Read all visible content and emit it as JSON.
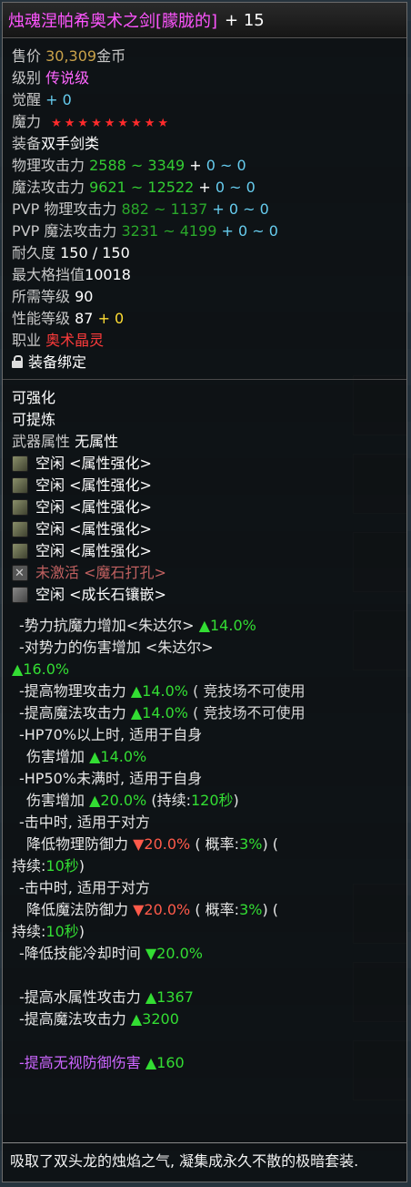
{
  "item": {
    "name": "烛魂涅帕希奥术之剑[朦胧的]",
    "enhance": "+ 15",
    "price_label": "售价",
    "price_value": "30,309",
    "price_unit": "金币",
    "grade_label": "级别",
    "grade_value": "传说级",
    "awaken_label": "觉醒",
    "awaken_value": "+ 0",
    "magic_label": "魔力",
    "stars": [
      "★",
      "★",
      "★",
      "★",
      "★",
      "★",
      "★",
      "★",
      "★"
    ],
    "equip_label": "装备",
    "equip_value": "双手剑类",
    "phys_label": "物理攻击力",
    "phys_value": "2588 ~ 3349",
    "phys_bonus_plus": "+",
    "phys_bonus": "0 ~ 0",
    "mag_label": "魔法攻击力",
    "mag_value": "9621 ~ 12522",
    "mag_bonus_plus": "+",
    "mag_bonus": "0 ~ 0",
    "pvp_phys_label": "PVP 物理攻击力",
    "pvp_phys_value": "882 ~ 1137",
    "pvp_phys_bonus": "+ 0 ~ 0",
    "pvp_mag_label": "PVP 魔法攻击力",
    "pvp_mag_value": "3231 ~ 4199",
    "pvp_mag_bonus": "+ 0 ~ 0",
    "durability_label": "耐久度",
    "durability_value": "150 / 150",
    "block_label": "最大格挡值",
    "block_value": "10018",
    "req_level_label": "所需等级",
    "req_level_value": "90",
    "perf_label": "性能等级",
    "perf_value": "87",
    "perf_bonus": "+ 0",
    "class_label": "职业",
    "class_value": "奥术晶灵",
    "bound_label": "装备绑定"
  },
  "sockets": {
    "enhanceable": "可强化",
    "refinable": "可提炼",
    "attr_label": "武器属性",
    "attr_value": "无属性",
    "slots": [
      {
        "state": "空闲",
        "desc": "<属性强化>"
      },
      {
        "state": "空闲",
        "desc": "<属性强化>"
      },
      {
        "state": "空闲",
        "desc": "<属性强化>"
      },
      {
        "state": "空闲",
        "desc": "<属性强化>"
      },
      {
        "state": "空闲",
        "desc": "<属性强化>"
      }
    ],
    "inactive_state": "未激活",
    "inactive_desc": "<魔石打孔>",
    "growth_state": "空闲",
    "growth_desc": "<成长石镶嵌>"
  },
  "effects": {
    "e1_text": "-势力抗魔力增加<朱达尔>",
    "e1_val": "▲14.0%",
    "e2_text": "-对势力的伤害增加 <朱达尔>",
    "e2_val": "▲16.0%",
    "e3_text": "-提高物理攻击力",
    "e3_val": "▲14.0%",
    "e3_note": "( 竞技场不可使用",
    "e4_text": "-提高魔法攻击力",
    "e4_val": "▲14.0%",
    "e4_note": "( 竞技场不可使用",
    "e5_line1": "-HP70%以上时, 适用于自身",
    "e5_text": "伤害增加",
    "e5_val": "▲14.0%",
    "e6_line1": "-HP50%未满时, 适用于自身",
    "e6_text": "伤害增加",
    "e6_val": "▲20.0%",
    "e6_dur_a": "(持续:",
    "e6_dur_b": "120秒",
    "e6_dur_c": ")",
    "e7_line1": "-击中时, 适用于对方",
    "e7_text": "降低物理防御力",
    "e7_val": "▼20.0%",
    "e7_rate_a": "( 概率:",
    "e7_rate_b": "3%",
    "e7_rate_c": ") (",
    "e7_dur_a": "持续:",
    "e7_dur_b": "10秒",
    "e7_dur_c": ")",
    "e8_line1": "-击中时, 适用于对方",
    "e8_text": "降低魔法防御力",
    "e8_val": "▼20.0%",
    "e8_rate_a": "( 概率:",
    "e8_rate_b": "3%",
    "e8_rate_c": ") (",
    "e8_dur_a": "持续:",
    "e8_dur_b": "10秒",
    "e8_dur_c": ")",
    "e9_text": "-降低技能冷却时间",
    "e9_val": "▼20.0%",
    "e10_text": "-提高水属性攻击力",
    "e10_val": "▲1367",
    "e11_text": "-提高魔法攻击力",
    "e11_val": "▲3200",
    "e12_text": "-提高无视防御伤害",
    "e12_val": "▲160"
  },
  "description": "吸取了双头龙的烛焰之气, 凝集成永久不散的极暗套装."
}
